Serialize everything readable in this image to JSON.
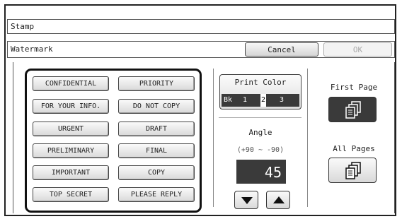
{
  "header": {
    "title": "Stamp"
  },
  "subheader": {
    "label": "Watermark",
    "cancel_label": "Cancel",
    "ok_label": "OK"
  },
  "stamps": {
    "items": [
      "CONFIDENTIAL",
      "PRIORITY",
      "FOR YOUR INFO.",
      "DO NOT COPY",
      "URGENT",
      "DRAFT",
      "PRELIMINARY",
      "FINAL",
      "IMPORTANT",
      "COPY",
      "TOP SECRET",
      "PLEASE REPLY"
    ]
  },
  "print_color": {
    "title": "Print Color",
    "options": [
      "Bk",
      "1",
      "2",
      "3"
    ],
    "selected": "2"
  },
  "angle": {
    "label": "Angle",
    "range": "(+90 ~ -90)",
    "value": "45"
  },
  "pages": {
    "first_label": "First Page",
    "all_label": "All Pages",
    "selected": "First Page"
  },
  "icons": {
    "down": "down-arrow-icon",
    "up": "up-arrow-icon",
    "pages": "pages-icon"
  }
}
